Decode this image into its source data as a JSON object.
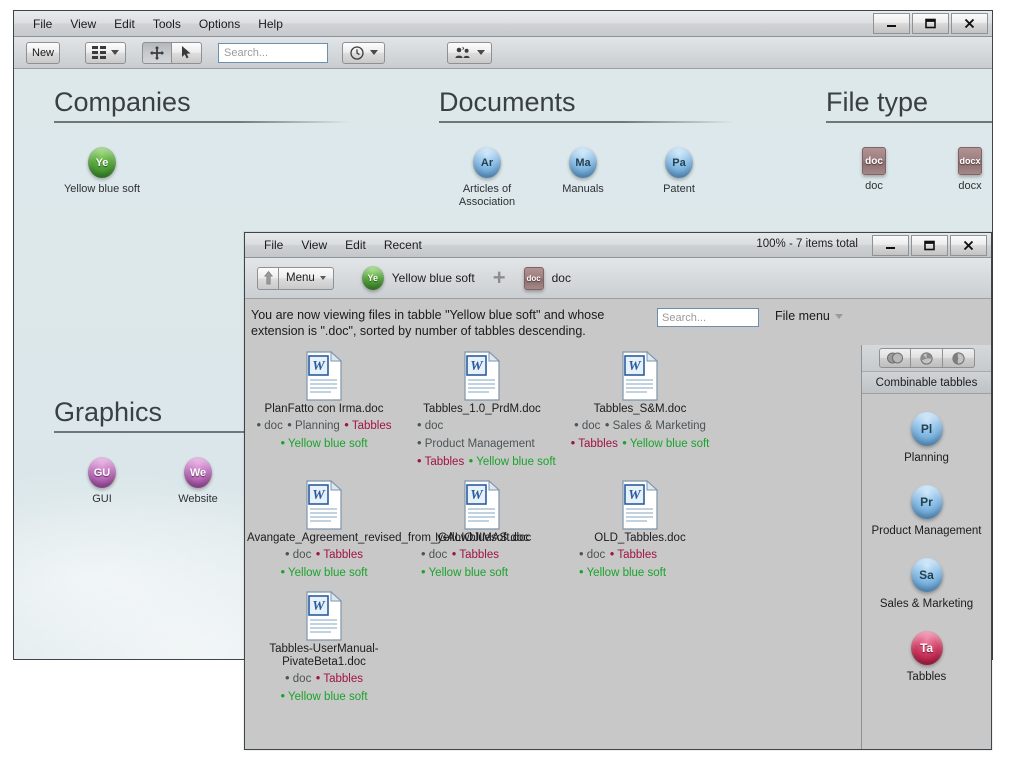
{
  "main_window": {
    "menu": [
      "File",
      "View",
      "Edit",
      "Tools",
      "Options",
      "Help"
    ],
    "window_controls": {
      "minimize": "_",
      "maximize": "❐",
      "close": "✕"
    },
    "toolbar": {
      "new_label": "New",
      "view_mode_icon": "grid-view-icon",
      "pan_icon": "move-tool-icon",
      "select_icon": "cursor-tool-icon",
      "search_placeholder": "Search...",
      "history_icon": "clock-icon",
      "people_icon": "users-icon"
    },
    "sections": [
      {
        "title": "Companies",
        "tiles": [
          {
            "abbr": "Ye",
            "label": "Yellow blue soft",
            "style": "green",
            "shape": "bubble"
          }
        ]
      },
      {
        "title": "Documents",
        "tiles": [
          {
            "abbr": "Ar",
            "label": "Articles of Association",
            "style": "blue",
            "shape": "bubble"
          },
          {
            "abbr": "Ma",
            "label": "Manuals",
            "style": "blue",
            "shape": "bubble"
          },
          {
            "abbr": "Pa",
            "label": "Patent",
            "style": "blue",
            "shape": "bubble"
          }
        ]
      },
      {
        "title": "File type",
        "tiles": [
          {
            "abbr": "doc",
            "label": "doc",
            "style": "doc",
            "shape": "badge"
          },
          {
            "abbr": "docx",
            "label": "docx",
            "style": "doc",
            "shape": "badge"
          }
        ]
      },
      {
        "title": "Graphics",
        "tiles": [
          {
            "abbr": "GU",
            "label": "GUI",
            "style": "purple",
            "shape": "bubble"
          },
          {
            "abbr": "We",
            "label": "Website",
            "style": "purple",
            "shape": "bubble"
          }
        ]
      }
    ]
  },
  "inner_window": {
    "menu": [
      "File",
      "View",
      "Edit",
      "Recent"
    ],
    "status": "100% - 7 items total",
    "window_controls": {
      "minimize": "_",
      "maximize": "❐",
      "close": "✕"
    },
    "toolbar": {
      "up_icon": "arrow-up-icon",
      "menu_label": "Menu",
      "breadcrumb": [
        {
          "abbr": "Ye",
          "label": "Yellow blue soft",
          "style": "green",
          "shape": "bubble"
        },
        {
          "abbr": "doc",
          "label": "doc",
          "style": "doc",
          "shape": "badge"
        }
      ],
      "separator": "+"
    },
    "description": "You are now viewing files in tabble \"Yellow blue soft\"  and  whose extension is \".doc\", sorted by number of tabbles descending.",
    "search_placeholder": "Search...",
    "file_menu_label": "File menu",
    "files": [
      {
        "name": "PlanFatto con Irma.doc",
        "icon": "word-document-icon",
        "tag_lines": [
          [
            {
              "text": "doc",
              "color": "grey"
            },
            {
              "text": "Planning",
              "color": "grey"
            },
            {
              "text": "Tabbles",
              "color": "crimson"
            }
          ],
          [
            {
              "text": "Yellow blue soft",
              "color": "green"
            }
          ]
        ]
      },
      {
        "name": "Tabbles_1.0_PrdM.doc",
        "icon": "word-document-icon",
        "tag_lines": [
          [
            {
              "text": "doc",
              "color": "grey"
            }
          ],
          [
            {
              "text": "Product Management",
              "color": "grey"
            }
          ],
          [
            {
              "text": "Tabbles",
              "color": "crimson"
            },
            {
              "text": "Yellow blue soft",
              "color": "green"
            }
          ]
        ]
      },
      {
        "name": "Tabbles_S&M.doc",
        "icon": "word-document-icon",
        "tag_lines": [
          [
            {
              "text": "doc",
              "color": "grey"
            },
            {
              "text": "Sales & Marketing",
              "color": "grey"
            }
          ],
          [
            {
              "text": "Tabbles",
              "color": "crimson"
            },
            {
              "text": "Yellow blue soft",
              "color": "green"
            }
          ]
        ]
      },
      {
        "name": "Avangate_Agreement_revised_from_yellowbluesoft.doc",
        "icon": "word-document-icon",
        "tag_lines": [
          [
            {
              "text": "doc",
              "color": "grey"
            },
            {
              "text": "Tabbles",
              "color": "crimson"
            }
          ],
          [
            {
              "text": "Yellow blue soft",
              "color": "green"
            }
          ]
        ]
      },
      {
        "name": "IGALIOJIMAS.doc",
        "icon": "word-document-icon",
        "tag_lines": [
          [
            {
              "text": "doc",
              "color": "grey"
            },
            {
              "text": "Tabbles",
              "color": "crimson"
            }
          ],
          [
            {
              "text": "Yellow blue soft",
              "color": "green"
            }
          ]
        ]
      },
      {
        "name": "OLD_Tabbles.doc",
        "icon": "word-document-icon",
        "tag_lines": [
          [
            {
              "text": "doc",
              "color": "grey"
            },
            {
              "text": "Tabbles",
              "color": "crimson"
            }
          ],
          [
            {
              "text": "Yellow blue soft",
              "color": "green"
            }
          ]
        ]
      },
      {
        "name": "Tabbles-UserManual-PivateBeta1.doc",
        "icon": "word-document-icon",
        "tag_lines": [
          [
            {
              "text": "doc",
              "color": "grey"
            },
            {
              "text": "Tabbles",
              "color": "crimson"
            }
          ],
          [
            {
              "text": "Yellow blue soft",
              "color": "green"
            }
          ]
        ]
      }
    ],
    "sidebar": {
      "tool_icons": [
        "venn-overlap-icon",
        "pie-segment-icon",
        "pie-slice-icon"
      ],
      "header": "Combinable tabbles",
      "items": [
        {
          "abbr": "Pl",
          "label": "Planning",
          "style": "blue"
        },
        {
          "abbr": "Pr",
          "label": "Product Management",
          "style": "blue"
        },
        {
          "abbr": "Sa",
          "label": "Sales & Marketing",
          "style": "blue"
        },
        {
          "abbr": "Ta",
          "label": "Tabbles",
          "style": "red"
        }
      ]
    }
  },
  "colors": {
    "desktop_bg": "#ffffff",
    "main_bg": "#dde7ea",
    "inner_bg": "#c8c8c8",
    "tag_grey": "#4d5356",
    "tag_crimson": "#a01346",
    "tag_green": "#1aa32b"
  }
}
